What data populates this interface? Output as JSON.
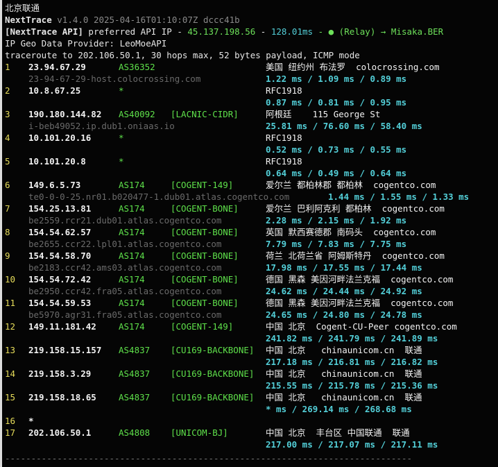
{
  "header": {
    "title": "北京联通",
    "app_name": "NextTrace",
    "version": "v1.4.0 2025-04-16T01:10:07Z dccc41b",
    "api_prefix": "[NextTrace API]",
    "api_text": " preferred API IP - ",
    "api_ip": "45.137.198.56",
    "api_sep": " - ",
    "api_latency": "128.01ms",
    "api_relay": " - ● (Relay) → Misaka.BER",
    "geo_provider": "IP Geo Data Provider: LeoMoeAPI",
    "traceroute": "traceroute to 202.106.50.1, 30 hops max, 52 bytes payload, ICMP mode"
  },
  "hops": [
    {
      "n": "1",
      "ip": "23.94.67.29",
      "as": "AS36352",
      "tag": "",
      "geo": "美国 纽约州 布法罗  colocrossing.com",
      "host": "23-94-67-29-host.colocrossing.com",
      "rtt": "1.22 ms / 1.09 ms / 0.89 ms"
    },
    {
      "n": "2",
      "ip": "10.8.67.25",
      "as": "*",
      "tag": "",
      "geo": "RFC1918",
      "host": "",
      "rtt": "0.87 ms / 0.81 ms / 0.95 ms"
    },
    {
      "n": "3",
      "ip": "190.180.144.82",
      "as": "AS40092",
      "tag": "[LACNIC-CIDR]",
      "geo": "阿根廷    115 George St",
      "host": "i-beb49052.ip.dub1.oniaas.io",
      "rtt": "25.81 ms / 76.60 ms / 58.40 ms"
    },
    {
      "n": "4",
      "ip": "10.101.20.16",
      "as": "*",
      "tag": "",
      "geo": "RFC1918",
      "host": "",
      "rtt": "0.52 ms / 0.73 ms / 0.55 ms"
    },
    {
      "n": "5",
      "ip": "10.101.20.8",
      "as": "*",
      "tag": "",
      "geo": "RFC1918",
      "host": "",
      "rtt": "0.64 ms / 0.49 ms / 0.64 ms"
    },
    {
      "n": "6",
      "ip": "149.6.5.73",
      "as": "AS174",
      "tag": "[COGENT-149]",
      "geo": "爱尔兰 都柏林郡 都柏林  cogentco.com",
      "host": "te0-0-0-25.nr01.b020477-1.dub01.atlas.cogentco.com",
      "rtt": "1.44 ms / 1.55 ms / 1.33 ms",
      "rtt_shift": true
    },
    {
      "n": "7",
      "ip": "154.25.13.81",
      "as": "AS174",
      "tag": "[COGENT-BONE]",
      "geo": "爱尔兰 巴利阿克利 都柏林  cogentco.com",
      "host": "be2559.rcr21.dub01.atlas.cogentco.com",
      "rtt": "2.28 ms / 2.15 ms / 1.92 ms"
    },
    {
      "n": "8",
      "ip": "154.54.62.57",
      "as": "AS174",
      "tag": "[COGENT-BONE]",
      "geo": "英国 默西赛德郡 南码头  cogentco.com",
      "host": "be2655.ccr22.lpl01.atlas.cogentco.com",
      "rtt": "7.79 ms / 7.83 ms / 7.75 ms"
    },
    {
      "n": "9",
      "ip": "154.54.58.70",
      "as": "AS174",
      "tag": "[COGENT-BONE]",
      "geo": "荷兰 北荷兰省 阿姆斯特丹  cogentco.com",
      "host": "be2183.ccr42.ams03.atlas.cogentco.com",
      "rtt": "17.98 ms / 17.55 ms / 17.44 ms"
    },
    {
      "n": "10",
      "ip": "154.54.72.42",
      "as": "AS174",
      "tag": "[COGENT-BONE]",
      "geo": "德国 黑森 美因河畔法兰克福  cogentco.com",
      "host": "be2950.ccr42.fra05.atlas.cogentco.com",
      "rtt": "24.62 ms / 24.44 ms / 24.92 ms"
    },
    {
      "n": "11",
      "ip": "154.54.59.53",
      "as": "AS174",
      "tag": "[COGENT-BONE]",
      "geo": "德国 黑森 美因河畔法兰克福  cogentco.com",
      "host": "be5970.agr31.fra05.atlas.cogentco.com",
      "rtt": "24.65 ms / 24.80 ms / 24.78 ms"
    },
    {
      "n": "12",
      "ip": "149.11.181.42",
      "as": "AS174",
      "tag": "[COGENT-149]",
      "geo": "中国 北京  Cogent-CU-Peer cogentco.com",
      "host": "",
      "rtt": "241.82 ms / 241.79 ms / 241.89 ms"
    },
    {
      "n": "13",
      "ip": "219.158.15.157",
      "as": "AS4837",
      "tag": "[CU169-BACKBONE]",
      "geo": "中国 北京   chinaunicom.cn  联通",
      "host": "",
      "rtt": "217.18 ms / 216.81 ms / 216.82 ms"
    },
    {
      "n": "14",
      "ip": "219.158.3.29",
      "as": "AS4837",
      "tag": "[CU169-BACKBONE]",
      "geo": "中国 北京   chinaunicom.cn  联通",
      "host": "",
      "rtt": "215.55 ms / 215.78 ms / 215.36 ms"
    },
    {
      "n": "15",
      "ip": "219.158.18.65",
      "as": "AS4837",
      "tag": "[CU169-BACKBONE]",
      "geo": "中国 北京   chinaunicom.cn  联通",
      "host": "",
      "rtt": "* ms / 269.14 ms / 268.68 ms"
    },
    {
      "n": "16",
      "ip": "*",
      "as": "",
      "tag": "",
      "geo": "",
      "host": "",
      "rtt": "",
      "single": true
    },
    {
      "n": "17",
      "ip": "202.106.50.1",
      "as": "AS4808",
      "tag": "[UNICOM-BJ]",
      "geo": "中国 北京  丰台区 中国联通  联通",
      "host": "",
      "rtt": "217.00 ms / 217.07 ms / 217.11 ms"
    }
  ],
  "footer": {
    "divider": "------------------------------------------------------------------------------"
  }
}
